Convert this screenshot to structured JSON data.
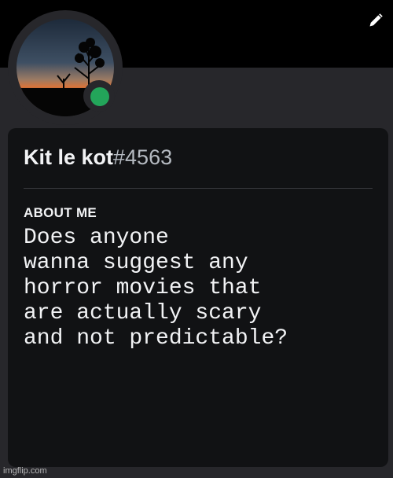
{
  "profile": {
    "username": "Kit le kot",
    "discriminator": "#4563",
    "status": "online",
    "status_color": "#23a55a",
    "about_me_title": "ABOUT ME",
    "about_me_text": "Does anyone\nwanna suggest any\nhorror movies that\nare actually scary\nand not predictable?"
  },
  "icons": {
    "edit": "pencil-icon"
  },
  "watermark": "imgflip.com",
  "colors": {
    "background": "#27272b",
    "card": "#111214",
    "banner": "#000000"
  }
}
